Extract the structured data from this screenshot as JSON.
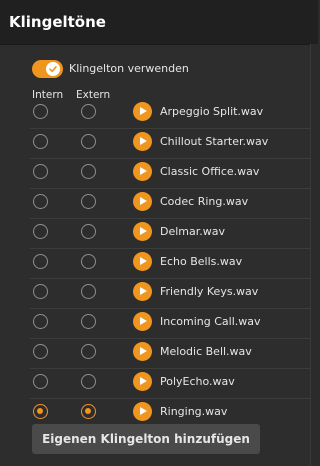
{
  "title": "Klingeltöne",
  "toggle": {
    "label": "Klingelton verwenden",
    "on": true
  },
  "columns": {
    "intern": "Intern",
    "extern": "Extern"
  },
  "ringtones": [
    {
      "name": "Arpeggio Split.wav",
      "intern": false,
      "extern": false
    },
    {
      "name": "Chillout Starter.wav",
      "intern": false,
      "extern": false
    },
    {
      "name": "Classic Office.wav",
      "intern": false,
      "extern": false
    },
    {
      "name": "Codec Ring.wav",
      "intern": false,
      "extern": false
    },
    {
      "name": "Delmar.wav",
      "intern": false,
      "extern": false
    },
    {
      "name": "Echo Bells.wav",
      "intern": false,
      "extern": false
    },
    {
      "name": "Friendly Keys.wav",
      "intern": false,
      "extern": false
    },
    {
      "name": "Incoming Call.wav",
      "intern": false,
      "extern": false
    },
    {
      "name": "Melodic Bell.wav",
      "intern": false,
      "extern": false
    },
    {
      "name": "PolyEcho.wav",
      "intern": false,
      "extern": false
    },
    {
      "name": "Ringing.wav",
      "intern": true,
      "extern": true
    }
  ],
  "add_button": "Eigenen Klingelton hinzufügen",
  "colors": {
    "accent": "#f0961e",
    "background": "#2d2d2d",
    "titlebar": "#202020"
  }
}
